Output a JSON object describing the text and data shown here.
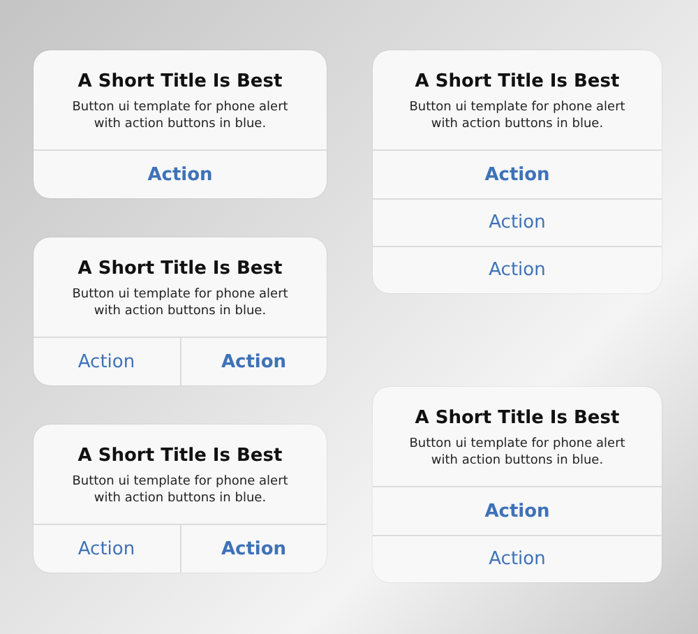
{
  "columns": [
    [
      {
        "title": "A Short Title Is Best",
        "message": "Button ui template for phone alert with action buttons in blue.",
        "kind": "stacked",
        "actions": [
          {
            "label": "Action",
            "emphasized": true
          }
        ]
      },
      {
        "title": "A Short Title Is Best",
        "message": "Button ui template for phone alert with action buttons in blue.",
        "kind": "sidebyside",
        "actions": [
          {
            "label": "Action",
            "emphasized": false
          },
          {
            "label": "Action",
            "emphasized": true
          }
        ]
      },
      {
        "title": "A Short Title Is Best",
        "message": "Button ui template for phone alert with action buttons in blue.",
        "kind": "sidebyside",
        "actions": [
          {
            "label": "Action",
            "emphasized": false
          },
          {
            "label": "Action",
            "emphasized": true
          }
        ]
      }
    ],
    [
      {
        "title": "A Short Title Is Best",
        "message": "Button ui template for phone alert with action buttons in blue.",
        "kind": "stacked",
        "actions": [
          {
            "label": "Action",
            "emphasized": true
          },
          {
            "label": "Action",
            "emphasized": false
          },
          {
            "label": "Action",
            "emphasized": false
          }
        ]
      },
      {
        "title": "A Short Title Is Best",
        "message": "Button ui template for phone alert with action buttons in blue.",
        "kind": "stacked",
        "actions": [
          {
            "label": "Action",
            "emphasized": true
          },
          {
            "label": "Action",
            "emphasized": false
          }
        ]
      }
    ]
  ]
}
